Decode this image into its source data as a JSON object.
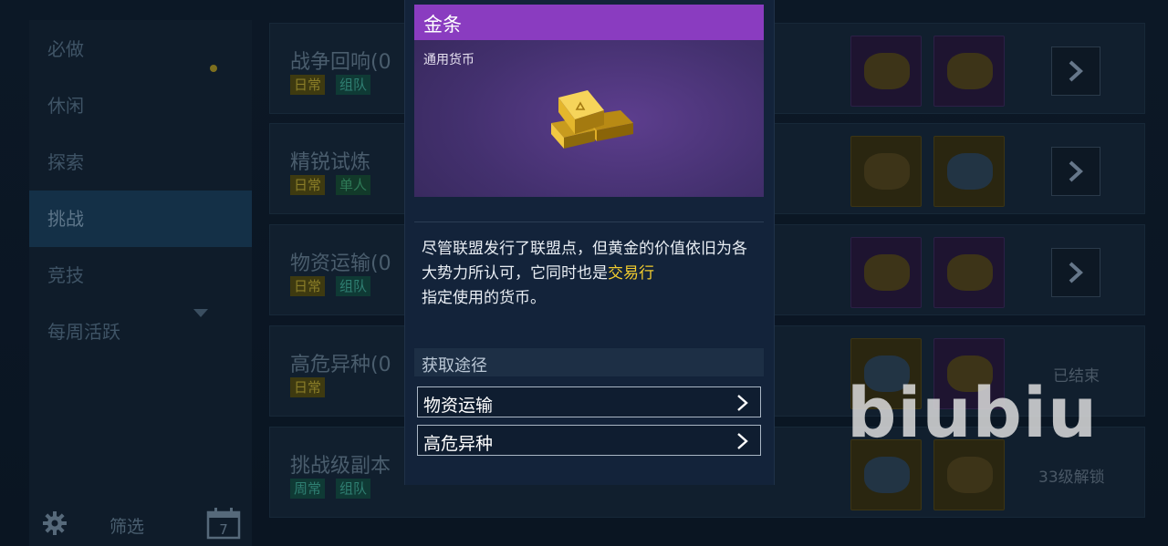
{
  "sidebar": {
    "items": [
      {
        "label": "必做"
      },
      {
        "label": "休闲"
      },
      {
        "label": "探索"
      },
      {
        "label": "挑战"
      },
      {
        "label": "竞技"
      },
      {
        "label": "每周活跃"
      }
    ],
    "active_index": 3,
    "filter_label": "筛选",
    "calendar_day": "7"
  },
  "activities": [
    {
      "title": "战争回响(0",
      "tags": [
        "日常",
        "组队"
      ],
      "rewards": [
        "medal-icon",
        "gold-bar-icon"
      ],
      "action": "arrow"
    },
    {
      "title": "精锐试炼",
      "tags": [
        "日常",
        "单人"
      ],
      "rewards": [
        "core-icon",
        "crystal-icon"
      ],
      "action": "arrow"
    },
    {
      "title": "物资运输(0",
      "tags": [
        "日常",
        "组队"
      ],
      "rewards": [
        "gold-bar-icon",
        "puzzle-icon"
      ],
      "action": "arrow"
    },
    {
      "title": "高危异种(0",
      "tags": [
        "日常"
      ],
      "rewards": [
        "chip-icon",
        "gold-bar-icon"
      ],
      "status": "已结束"
    },
    {
      "title": "挑战级副本",
      "tags": [
        "周常",
        "组队"
      ],
      "rewards": [
        "core-icon",
        "crystal-icon"
      ],
      "status": "33级解锁"
    }
  ],
  "popup": {
    "item_name": "金条",
    "item_type": "通用货币",
    "icon": "gold-bar-icon",
    "description_before": "尽管联盟发行了联盟点，但黄金的价值依旧为各大势力所认可，它同时也是",
    "description_highlight": "交易行",
    "description_after": "指定使用的货币。",
    "obtain_label": "获取途径",
    "sources": [
      {
        "label": "物资运输"
      },
      {
        "label": "高危异种"
      }
    ]
  },
  "watermark": "biubiu",
  "colors": {
    "rarity_purple": "#8a3cc0",
    "highlight": "#f2cc2e",
    "popup_bg": "#13233a"
  }
}
